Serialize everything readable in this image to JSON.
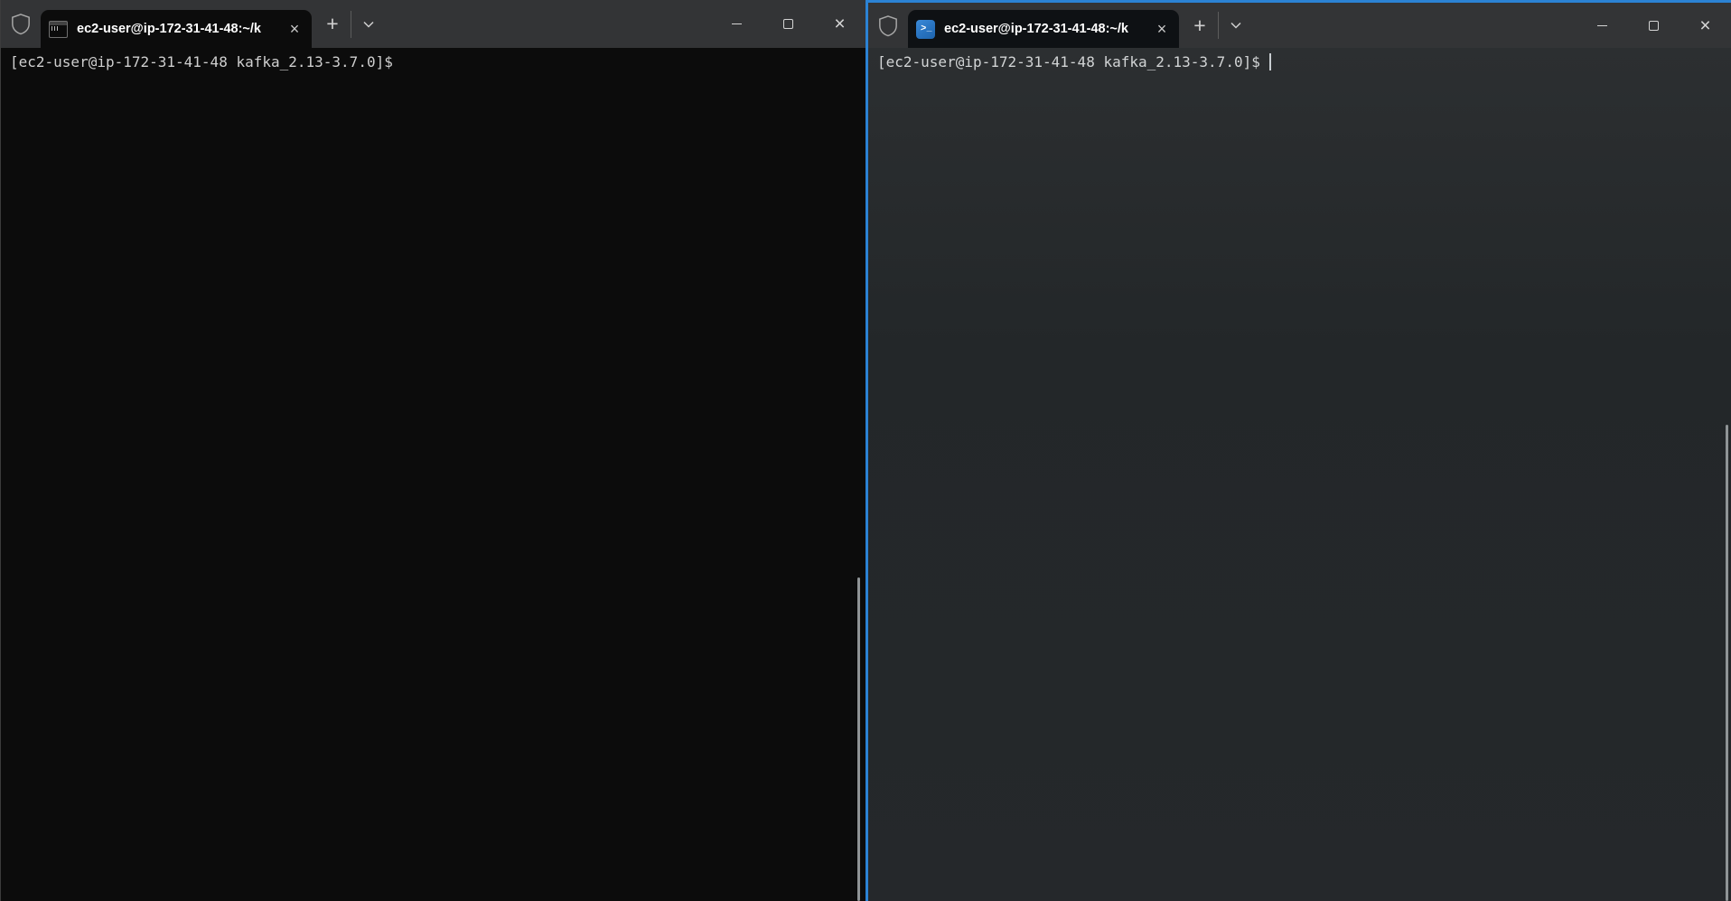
{
  "colors": {
    "focus_border": "#2b82d4",
    "titlebar_bg": "#333436",
    "left_terminal_bg": "#0c0c0c",
    "right_terminal_bg": "#25282b",
    "tab_bg_left": "#0c0c0c",
    "tab_bg_right": "#0e1114",
    "prompt_text": "#cfcfcf",
    "control_glyph": "#d4d4d4",
    "powershell_icon_bg": "#2a74c0"
  },
  "left_window": {
    "titlebar": {
      "shield_icon": "shield-icon",
      "tab": {
        "icon": "console-icon",
        "title": "ec2-user@ip-172-31-41-48:~/k",
        "close_glyph": "×"
      },
      "new_tab_glyph": "+",
      "dropdown_icon": "chevron-down-icon",
      "window_controls": {
        "minimize_icon": "minimize-icon",
        "maximize_icon": "maximize-icon",
        "close_glyph": "×"
      }
    },
    "terminal": {
      "prompt": "[ec2-user@ip-172-31-41-48 kafka_2.13-3.7.0]$",
      "cursor_visible": false
    }
  },
  "right_window": {
    "titlebar": {
      "shield_icon": "shield-icon",
      "tab": {
        "icon": "powershell-icon",
        "icon_arrow": ">",
        "icon_underscore": "_",
        "title": "ec2-user@ip-172-31-41-48:~/k",
        "close_glyph": "×"
      },
      "new_tab_glyph": "+",
      "dropdown_icon": "chevron-down-icon",
      "window_controls": {
        "minimize_icon": "minimize-icon",
        "maximize_icon": "maximize-icon",
        "close_glyph": "×"
      }
    },
    "terminal": {
      "prompt": "[ec2-user@ip-172-31-41-48 kafka_2.13-3.7.0]$",
      "cursor_visible": true
    }
  }
}
